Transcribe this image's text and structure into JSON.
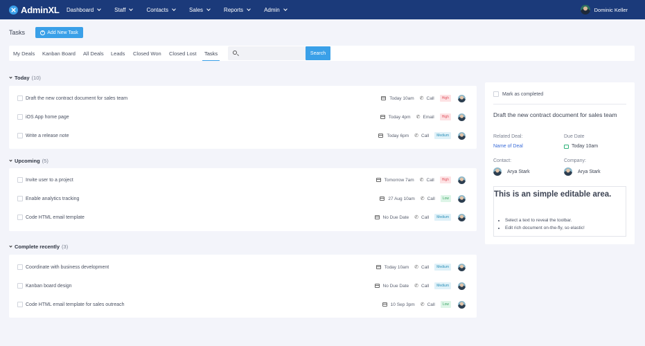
{
  "brand": {
    "name": "AdminXL"
  },
  "nav": [
    {
      "label": "Dashboard"
    },
    {
      "label": "Staff"
    },
    {
      "label": "Contacts"
    },
    {
      "label": "Sales"
    },
    {
      "label": "Reports"
    },
    {
      "label": "Admin"
    }
  ],
  "user": {
    "name": "Dominic Keller"
  },
  "page": {
    "title": "Tasks",
    "add_label": "Add New Task"
  },
  "tabs": [
    {
      "label": "My Deals"
    },
    {
      "label": "Kanban Board"
    },
    {
      "label": "All Deals"
    },
    {
      "label": "Leads"
    },
    {
      "label": "Closed Won"
    },
    {
      "label": "Closed Lost"
    },
    {
      "label": "Tasks"
    }
  ],
  "search": {
    "placeholder": "",
    "button_label": "Search"
  },
  "sections": [
    {
      "title": "Today",
      "count": "(10)",
      "tasks": [
        {
          "text": "Draft the new contract document for sales team",
          "date": "Today 10am",
          "type": "Call",
          "priority": "High"
        },
        {
          "text": "iOS App home page",
          "date": "Today 4pm",
          "type": "Email",
          "priority": "High"
        },
        {
          "text": "Write a release note",
          "date": "Today 6pm",
          "type": "Call",
          "priority": "Medium"
        }
      ]
    },
    {
      "title": "Upcoming",
      "count": "(5)",
      "tasks": [
        {
          "text": "Invite user to a project",
          "date": "Tomorrow 7am",
          "type": "Call",
          "priority": "High"
        },
        {
          "text": "Enable analytics tracking",
          "date": "27 Aug 10am",
          "type": "Call",
          "priority": "Low"
        },
        {
          "text": "Code HTML email template",
          "date": "No Due Date",
          "type": "Call",
          "priority": "Medium"
        }
      ]
    },
    {
      "title": "Complete recently",
      "count": "(3)",
      "tasks": [
        {
          "text": "Coordinate with business development",
          "date": "Today 10am",
          "type": "Call",
          "priority": "Medium"
        },
        {
          "text": "Kanban board design",
          "date": "No Due Date",
          "type": "Call",
          "priority": "Medium"
        },
        {
          "text": "Code HTML email template for sales outreach",
          "date": "10 Sep 3pm",
          "type": "Call",
          "priority": "Low"
        }
      ]
    }
  ],
  "detail": {
    "mark_label": "Mark as completed",
    "title": "Draft the new contract document for sales team",
    "related_deal_label": "Related Deal:",
    "related_deal_value": "Name of Deal",
    "due_date_label": "Due Date",
    "due_date_value": "Today 10am",
    "contact_label": "Contact:",
    "contact_value": "Arya Stark",
    "company_label": "Company:",
    "company_value": "Arya Stark",
    "editor": {
      "title": "This is an simple editable area.",
      "bullets": [
        "Select a text to reveal the toolbar.",
        "Edit rich document on-the-fly, so elastic!"
      ]
    }
  },
  "colors": {
    "topbar": "#1b3a7a",
    "accent": "#3aa0e8",
    "high": "#e0505c",
    "medium": "#2a8fb8",
    "low": "#3ea566"
  }
}
